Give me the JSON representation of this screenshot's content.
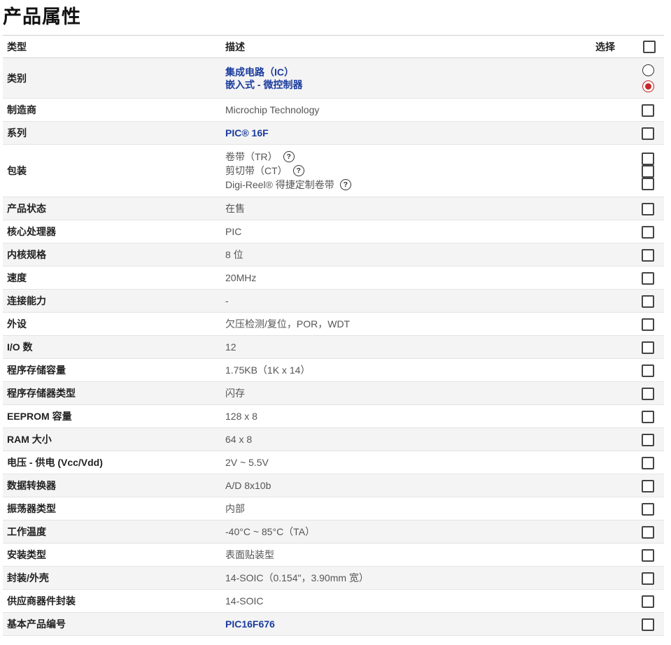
{
  "title": "产品属性",
  "header": {
    "type": "类型",
    "desc": "描述",
    "select": "选择"
  },
  "rows": {
    "category": {
      "label": "类别",
      "links": [
        "集成电路（IC）",
        "嵌入式 - 微控制器"
      ]
    },
    "manufacturer": {
      "label": "制造商",
      "value": "Microchip Technology"
    },
    "series": {
      "label": "系列",
      "value": "PIC® 16F"
    },
    "packaging": {
      "label": "包装",
      "options": [
        "卷带（TR）",
        "剪切带（CT）",
        "Digi-Reel® 得捷定制卷带"
      ]
    },
    "status": {
      "label": "产品状态",
      "value": "在售"
    },
    "core": {
      "label": "核心处理器",
      "value": "PIC"
    },
    "core_size": {
      "label": "内核规格",
      "value": "8 位"
    },
    "speed": {
      "label": "速度",
      "value": "20MHz"
    },
    "connectivity": {
      "label": "连接能力",
      "value": "-"
    },
    "peripherals": {
      "label": "外设",
      "value": "欠压检测/复位，POR，WDT"
    },
    "io": {
      "label": "I/O 数",
      "value": "12"
    },
    "prog_mem": {
      "label": "程序存储容量",
      "value": "1.75KB（1K x 14）"
    },
    "prog_mem_type": {
      "label": "程序存储器类型",
      "value": "闪存"
    },
    "eeprom": {
      "label": "EEPROM 容量",
      "value": "128 x 8"
    },
    "ram": {
      "label": "RAM 大小",
      "value": "64 x 8"
    },
    "voltage": {
      "label": "电压 - 供电 (Vcc/Vdd)",
      "value": "2V ~ 5.5V"
    },
    "converter": {
      "label": "数据转换器",
      "value": "A/D 8x10b"
    },
    "oscillator": {
      "label": "振荡器类型",
      "value": "内部"
    },
    "temp": {
      "label": "工作温度",
      "value": "-40°C ~ 85°C（TA）"
    },
    "mounting": {
      "label": "安装类型",
      "value": "表面贴装型"
    },
    "package": {
      "label": "封装/外壳",
      "value": "14-SOIC（0.154\"，3.90mm 宽）"
    },
    "supplier_pkg": {
      "label": "供应商器件封装",
      "value": "14-SOIC"
    },
    "base_part": {
      "label": "基本产品编号",
      "value": "PIC16F676"
    }
  },
  "category_selected_index": 1,
  "help_glyph": "?",
  "icons": {
    "help": "question-circle-icon",
    "checkbox": "checkbox-icon",
    "radio": "radio-icon"
  },
  "colors": {
    "link": "#1b3c9e",
    "radio_selected": "#c62828",
    "row_alt": "#f4f4f4"
  }
}
